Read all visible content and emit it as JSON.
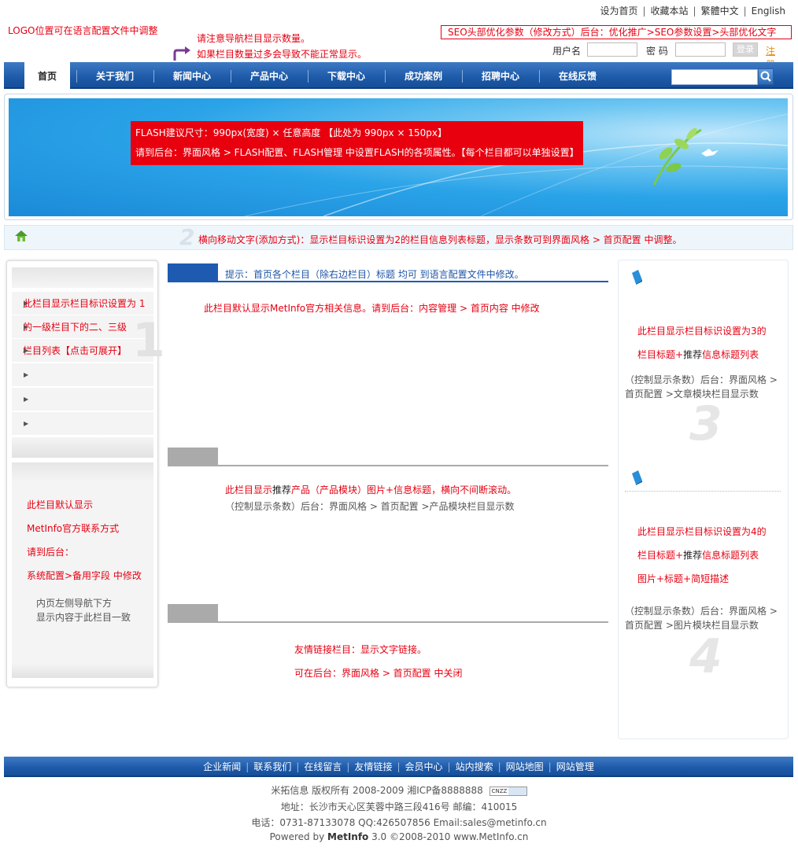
{
  "top_links": [
    "设为首页",
    "收藏本站",
    "繁體中文",
    "English"
  ],
  "logo_note": "LOGO位置可在语言配置文件中调整",
  "nav_note": [
    "请注意导航栏目显示数量。",
    "如果栏目数量过多会导致不能正常显示。"
  ],
  "seo_note": "SEO头部优化参数（修改方式）后台：优化推广>SEO参数设置>头部优化文字",
  "login": {
    "username_label": "用户名",
    "password_label": "密  码",
    "login_button": "登录",
    "register_link": "注册"
  },
  "nav": {
    "items": [
      "首页",
      "关于我们",
      "新闻中心",
      "产品中心",
      "下载中心",
      "成功案例",
      "招聘中心",
      "在线反馈"
    ],
    "active": "首页"
  },
  "banner": {
    "line1": "FLASH建议尺寸：990px(宽度) × 任意高度 【此处为 990px × 150px】",
    "line2": "请到后台：界面风格 > FLASH配置、FLASH管理 中设置FLASH的各项属性。【每个栏目都可以单独设置】"
  },
  "marquee": {
    "number": "2",
    "text": "横向移动文字(添加方式)：显示栏目标识设置为2的栏目信息列表标题，显示条数可到界面风格 > 首页配置 中调整。"
  },
  "left": {
    "rows": [
      "此栏目显示栏目标识设置为 1",
      "的一级栏目下的二、三级",
      "栏目列表【点击可展开】",
      "",
      "",
      ""
    ],
    "big_number": "1",
    "contact": [
      "此栏目默认显示",
      "MetInfo官方联系方式",
      "请到后台：",
      "系统配置>备用字段 中修改"
    ],
    "contact_note": [
      "内页左侧导航下方",
      "显示内容于此栏目一致"
    ]
  },
  "middle": {
    "tip": "提示：首页各个栏目（除右边栏目）标题 均可 到语言配置文件中修改。",
    "about": "此栏目默认显示MetInfo官方相关信息。请到后台：内容管理 > 首页内容 中修改",
    "product_prefix": "此栏目显示",
    "product_bold": "推荐",
    "product_suffix": "产品（产品模块）图片+信息标题，横向不间断滚动。",
    "product_note": "（控制显示条数）后台：界面风格 > 首页配置 >产品模块栏目显示数",
    "links1": "友情链接栏目：显示文字链接。",
    "links2": "可在后台：界面风格 > 首页配置 中关闭"
  },
  "right": {
    "block3": {
      "line1": "此栏目显示栏目标识设置为3的",
      "line2_pre": "栏目标题+",
      "line2_bold": "推荐",
      "line2_post": "信息标题列表",
      "note1": "（控制显示条数）后台：界面风格 >",
      "note2": "首页配置 >文章模块栏目显示数",
      "number": "3"
    },
    "block4": {
      "line1": "此栏目显示栏目标识设置为4的",
      "line2_pre": "栏目标题+",
      "line2_bold": "推荐",
      "line2_post": "信息标题列表",
      "line3": "图片+标题+简短描述",
      "note1": "（控制显示条数）后台：界面风格 >",
      "note2": "首页配置 >图片模块栏目显示数",
      "number": "4"
    }
  },
  "footer": {
    "nav": [
      "企业新闻",
      "联系我们",
      "在线留言",
      "友情链接",
      "会员中心",
      "站内搜索",
      "网站地图",
      "网站管理"
    ],
    "copyright": "米拓信息 版权所有 2008-2009 湘ICP备8888888",
    "badge": "CNZZ",
    "address": "地址：长沙市天心区芙蓉中路三段416号 邮编：410015",
    "phone": "电话：0731-87133078 QQ:426507856 Email:sales@metinfo.cn",
    "powered_pre": "Powered by ",
    "powered_brand": "MetInfo",
    "powered_post": " 3.0 ©2008-2010 www.MetInfo.cn"
  }
}
